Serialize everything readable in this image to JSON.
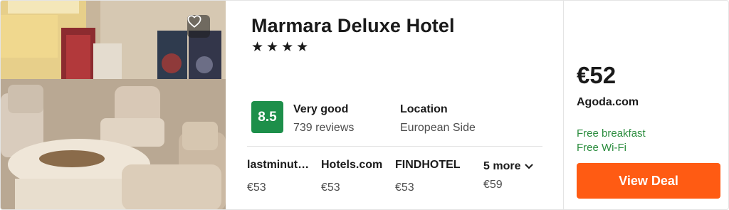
{
  "hotel": {
    "name": "Marmara Deluxe Hotel",
    "stars": "★★★★",
    "favorite_icon": "heart-outline-icon"
  },
  "rating": {
    "score": "8.5",
    "word": "Very good",
    "count": "739 reviews",
    "badge_color": "#1d8f4a"
  },
  "location": {
    "title": "Location",
    "value": "European Side"
  },
  "providers": [
    {
      "name": "lastminut…",
      "price": "€53"
    },
    {
      "name": "Hotels.com",
      "price": "€53"
    },
    {
      "name": "FINDHOTEL",
      "price": "€53"
    }
  ],
  "more": {
    "label": "5 more",
    "price": "€59",
    "icon": "chevron-down-icon"
  },
  "deal": {
    "price": "€52",
    "agent": "Agoda.com",
    "perks": [
      "Free breakfast",
      "Free Wi-Fi"
    ],
    "button_label": "View Deal",
    "accent_color": "#ff5b13",
    "perk_color": "#2a8c3d"
  }
}
